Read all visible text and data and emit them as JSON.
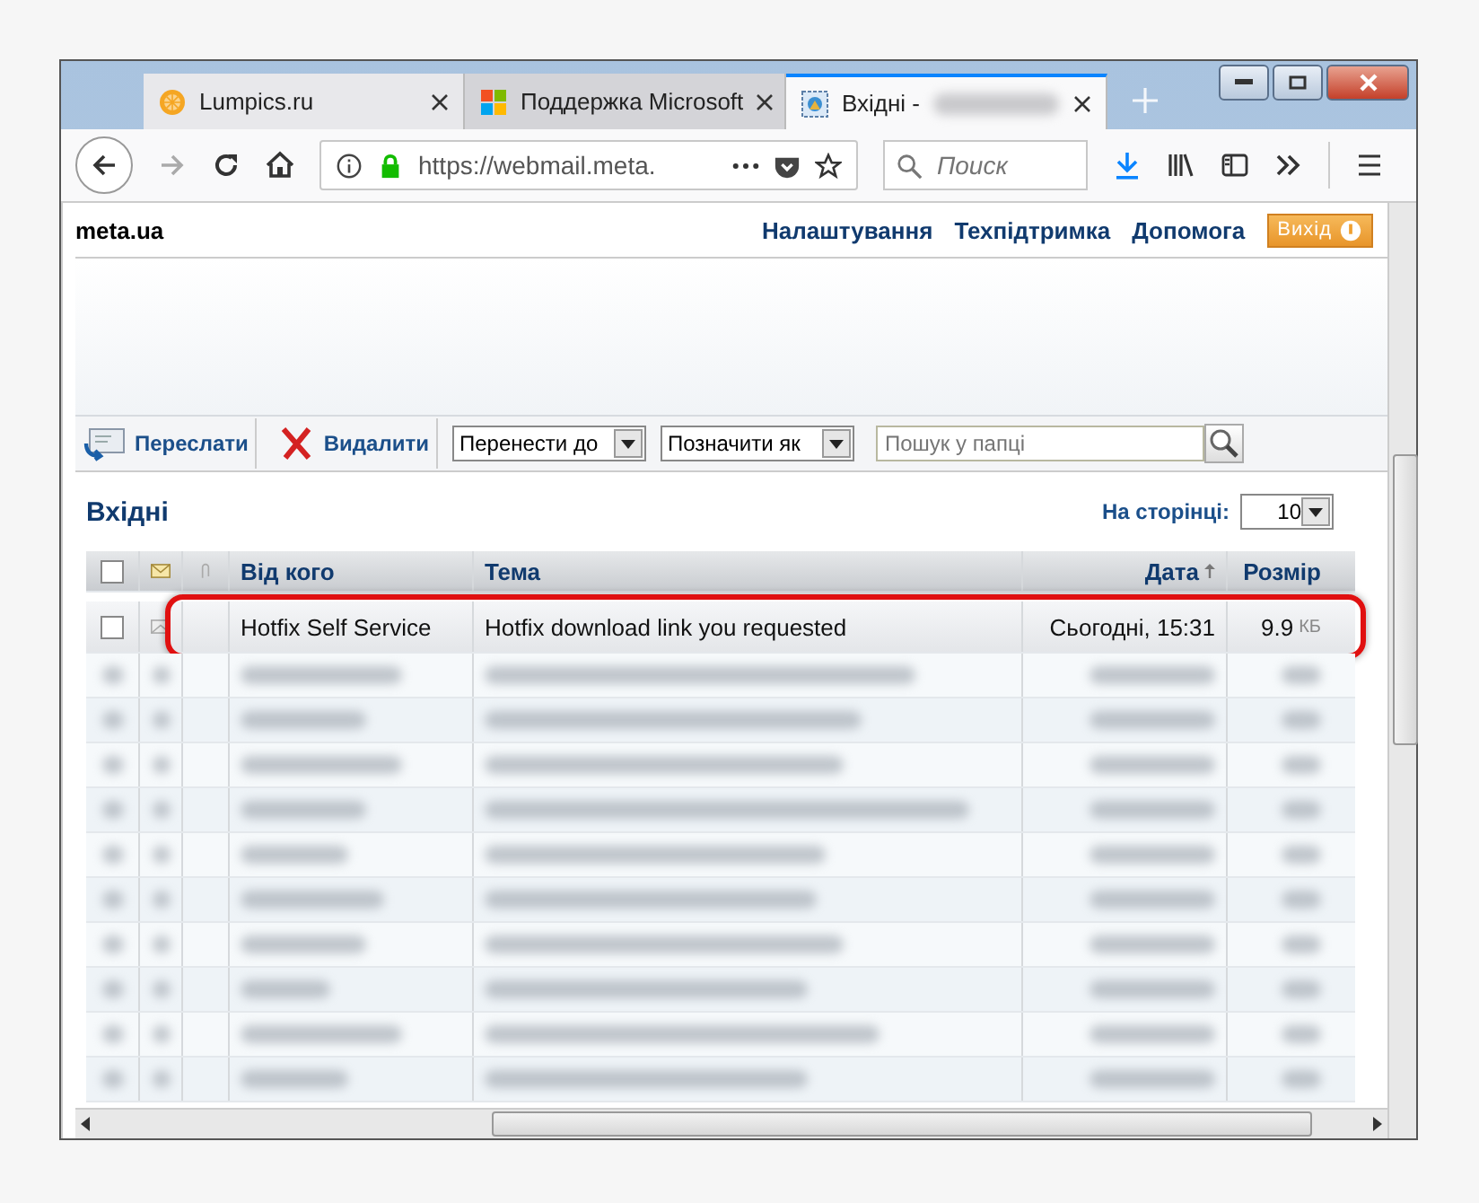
{
  "browser": {
    "tabs": [
      {
        "title": "Lumpics.ru",
        "selected": false,
        "kind": "orange"
      },
      {
        "title": "Поддержка Microsoft",
        "selected": false,
        "kind": "windows"
      },
      {
        "title": "Вхідні -",
        "selected": true,
        "kind": "mail"
      }
    ],
    "url": "https://webmail.meta.",
    "search": {
      "placeholder": "Поиск"
    }
  },
  "site": {
    "logo": "meta.ua",
    "links": [
      "Налаштування",
      "Техпідтримка",
      "Допомога"
    ],
    "logout": "Вихід"
  },
  "toolbar": {
    "forward": "Переслати",
    "delete": "Видалити",
    "move": "Перенести до",
    "mark": "Позначити як",
    "search": {
      "placeholder": "Пошук у папці"
    }
  },
  "folder": {
    "title": "Вхідні",
    "per_page_label": "На сторінці:",
    "per_page": "10"
  },
  "table": {
    "header_checked": false,
    "columns": [
      "Від кого",
      "Тема",
      "Дата",
      "Розмір"
    ],
    "rows": [
      {
        "kind": "message",
        "from": "Hotfix Self Service",
        "subject": "Hotfix download link you requested",
        "date": "Сьогодні, 15:31",
        "size": "9.9",
        "unit": "КБ",
        "checked": false,
        "highlighted": true
      },
      {
        "kind": "blurred"
      },
      {
        "kind": "blurred"
      },
      {
        "kind": "blurred"
      },
      {
        "kind": "blurred"
      },
      {
        "kind": "blurred"
      },
      {
        "kind": "blurred"
      },
      {
        "kind": "blurred"
      },
      {
        "kind": "blurred"
      },
      {
        "kind": "blurred"
      },
      {
        "kind": "blurred"
      }
    ]
  }
}
